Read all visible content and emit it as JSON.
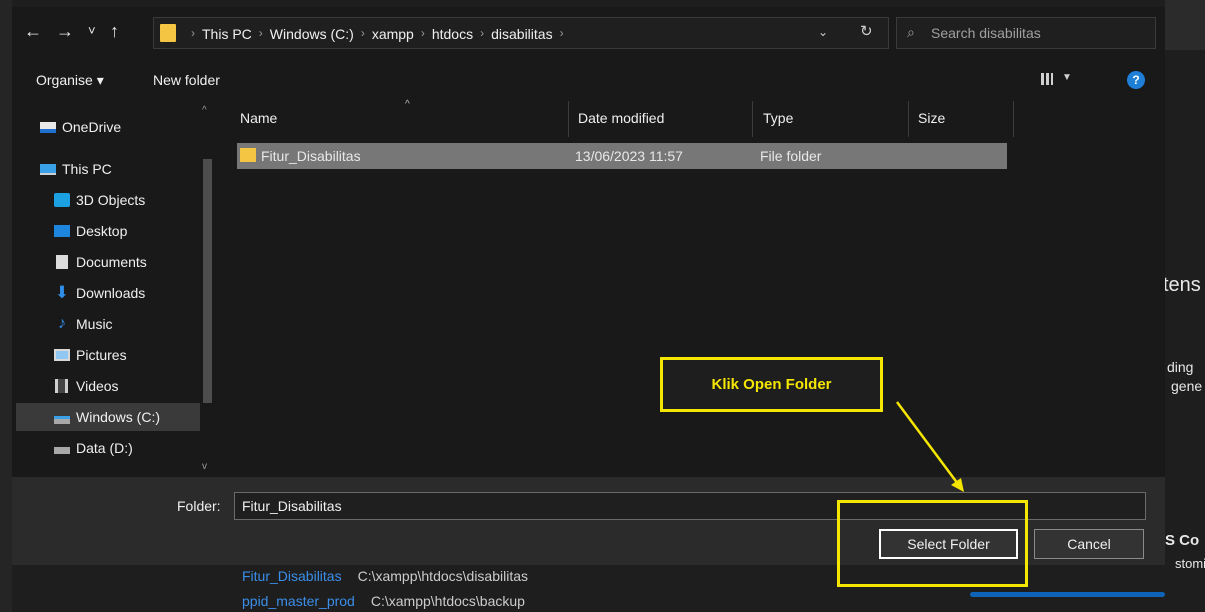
{
  "nav": {
    "back": "←",
    "forward": "→",
    "recent": "˅",
    "up": "↑"
  },
  "address": {
    "crumbs": [
      "This PC",
      "Windows (C:)",
      "xampp",
      "htdocs",
      "disabilitas"
    ],
    "separator": "›",
    "dropdown": "⌄",
    "refresh": "↻"
  },
  "search": {
    "placeholder": "Search disabilitas",
    "icon": "search-icon"
  },
  "toolbar": {
    "organise": "Organise ▾",
    "new_folder": "New folder",
    "help": "?"
  },
  "sidebar": {
    "items": [
      {
        "label": "OneDrive",
        "icon": "onedrive-icon"
      },
      {
        "label": "This PC",
        "icon": "pc-icon"
      },
      {
        "label": "3D Objects",
        "icon": "3d-objects-icon"
      },
      {
        "label": "Desktop",
        "icon": "desktop-icon"
      },
      {
        "label": "Documents",
        "icon": "documents-icon"
      },
      {
        "label": "Downloads",
        "icon": "downloads-icon"
      },
      {
        "label": "Music",
        "icon": "music-icon"
      },
      {
        "label": "Pictures",
        "icon": "pictures-icon"
      },
      {
        "label": "Videos",
        "icon": "videos-icon"
      },
      {
        "label": "Windows (C:)",
        "icon": "windows-drive-icon"
      },
      {
        "label": "Data (D:)",
        "icon": "drive-icon"
      }
    ]
  },
  "files": {
    "columns": [
      "Name",
      "Date modified",
      "Type",
      "Size"
    ],
    "rows": [
      {
        "name": "Fitur_Disabilitas",
        "date": "13/06/2023 11:57",
        "type": "File folder",
        "size": ""
      }
    ]
  },
  "bottom": {
    "folder_label": "Folder:",
    "folder_value": "Fitur_Disabilitas",
    "select_button": "Select Folder",
    "cancel_button": "Cancel"
  },
  "annotation": {
    "label": "Klik Open Folder",
    "color": "#f5e600"
  },
  "background": {
    "right_texts": [
      "tens",
      "ding",
      "gene",
      "S Co",
      "stomi"
    ],
    "bottom_rows": [
      {
        "name": "Fitur_Disabilitas",
        "path": "C:\\xampp\\htdocs\\disabilitas"
      },
      {
        "name": "ppid_master_prod",
        "path": "C:\\xampp\\htdocs\\backup"
      }
    ]
  }
}
